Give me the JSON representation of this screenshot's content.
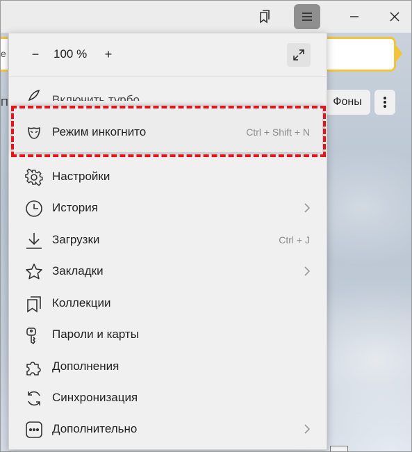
{
  "zoom": {
    "minus": "−",
    "value": "100 %",
    "plus": "+"
  },
  "address_bar": {
    "left_text": "e"
  },
  "page": {
    "left_chip": "Пе",
    "fony_label": "Фоны"
  },
  "menu": {
    "turbo_label": "Включить турбо",
    "incognito": {
      "label": "Режим инкогнито",
      "shortcut": "Ctrl + Shift + N"
    },
    "items": [
      {
        "label": "Настройки",
        "icon": "gear-icon"
      },
      {
        "label": "История",
        "icon": "clock-icon",
        "submenu": true
      },
      {
        "label": "Загрузки",
        "icon": "download-icon",
        "shortcut": "Ctrl + J"
      },
      {
        "label": "Закладки",
        "icon": "star-icon",
        "submenu": true
      },
      {
        "label": "Коллекции",
        "icon": "collections-icon"
      },
      {
        "label": "Пароли и карты",
        "icon": "key-icon"
      },
      {
        "label": "Дополнения",
        "icon": "puzzle-icon"
      },
      {
        "label": "Синхронизация",
        "icon": "sync-icon"
      },
      {
        "label": "Дополнительно",
        "icon": "more-icon",
        "submenu": true
      }
    ]
  },
  "colors": {
    "highlight": "#e0161c",
    "address_border": "#f3c43a",
    "menu_button_active": "#8f8f8f"
  }
}
